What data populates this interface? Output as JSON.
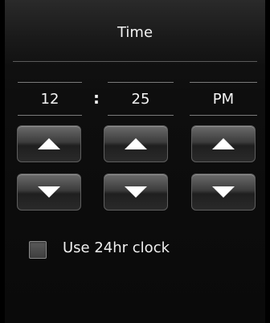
{
  "header": {
    "title": "Time"
  },
  "time": {
    "hour": "12",
    "separator": ":",
    "minute": "25",
    "period": "PM"
  },
  "controls": {
    "up_icon": "triangle-up-icon",
    "down_icon": "triangle-down-icon"
  },
  "options": {
    "use_24hr_label": "Use 24hr clock",
    "use_24hr_checked": false
  },
  "colors": {
    "background": "#0e0e0e",
    "text": "#f5f5f5",
    "button": "#3c3c3c"
  }
}
